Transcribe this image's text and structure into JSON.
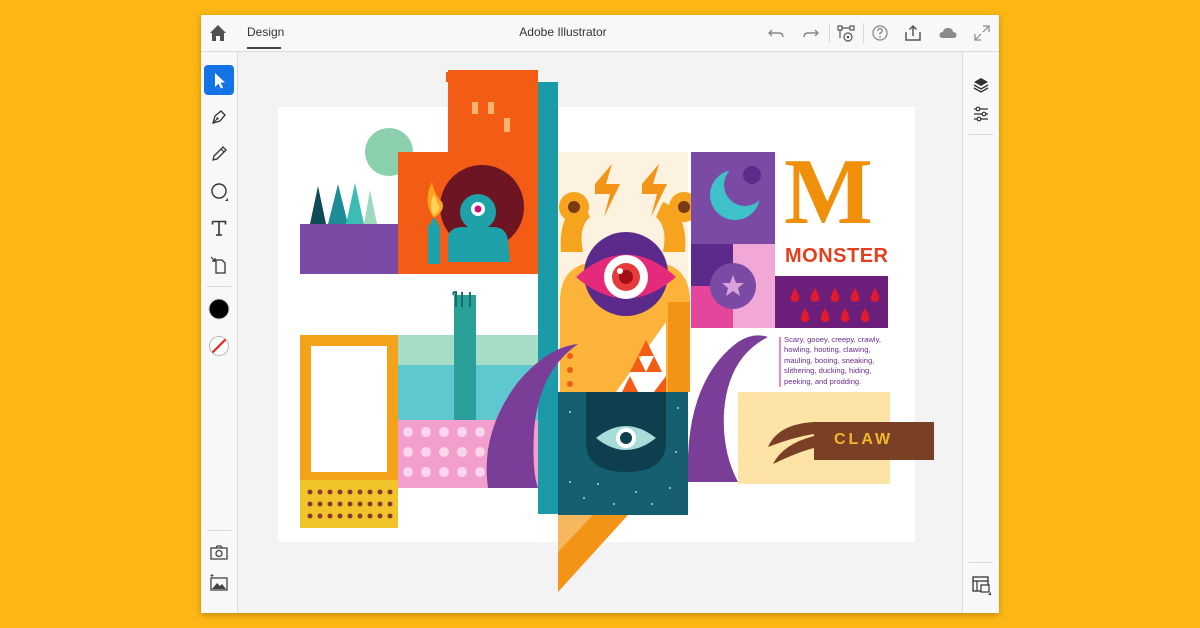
{
  "app": {
    "title": "Adobe Illustrator"
  },
  "tabs": [
    {
      "label": "Design",
      "active": true
    }
  ],
  "topbar_icons": [
    "home-icon",
    "undo-icon",
    "redo-icon",
    "path-edit-icon",
    "help-icon",
    "share-icon",
    "cloud-icon",
    "fullscreen-icon"
  ],
  "left_tools": [
    "selection-tool-icon",
    "pen-tool-icon",
    "pencil-tool-icon",
    "shape-tool-icon",
    "type-tool-icon",
    "place-image-tool-icon"
  ],
  "colors": {
    "fill": "#000000",
    "stroke": "none",
    "accent": "#1473e6",
    "background": "#fdb714"
  },
  "right_panel_icons": [
    "layers-icon",
    "properties-icon",
    "artboards-icon"
  ],
  "bottom_left_icons": [
    "camera-capture-icon",
    "image-capture-icon"
  ],
  "artwork": {
    "letter": "M",
    "heading": "MONSTER",
    "description": "Scary, gooey, creepy, crawly, howling, hooting, clawing, mauling, booing, sneaking, slithering, ducking, hiding, peeking, and prodding.",
    "claw_label": "CLAW"
  }
}
